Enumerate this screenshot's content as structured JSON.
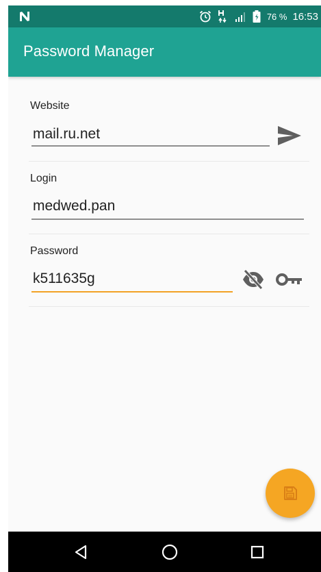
{
  "status_bar": {
    "battery_percent": "76 %",
    "time": "16:53",
    "icons": [
      "n-logo-icon",
      "alarm-icon",
      "data-arrows-icon",
      "signal-icon",
      "battery-icon"
    ]
  },
  "app_bar": {
    "title": "Password Manager",
    "color": "#1fa393"
  },
  "form": {
    "website": {
      "label": "Website",
      "value": "mail.ru.net",
      "action_icon": "send-icon"
    },
    "login": {
      "label": "Login",
      "value": "medwed.pan"
    },
    "password": {
      "label": "Password",
      "value": "k511635g",
      "focused": true,
      "action_icons": [
        "visibility-off-icon",
        "key-icon"
      ]
    }
  },
  "fab": {
    "icon": "save-icon",
    "color": "#f5a623"
  },
  "nav_bar": {
    "icons": [
      "back-icon",
      "home-icon",
      "recents-icon"
    ]
  }
}
